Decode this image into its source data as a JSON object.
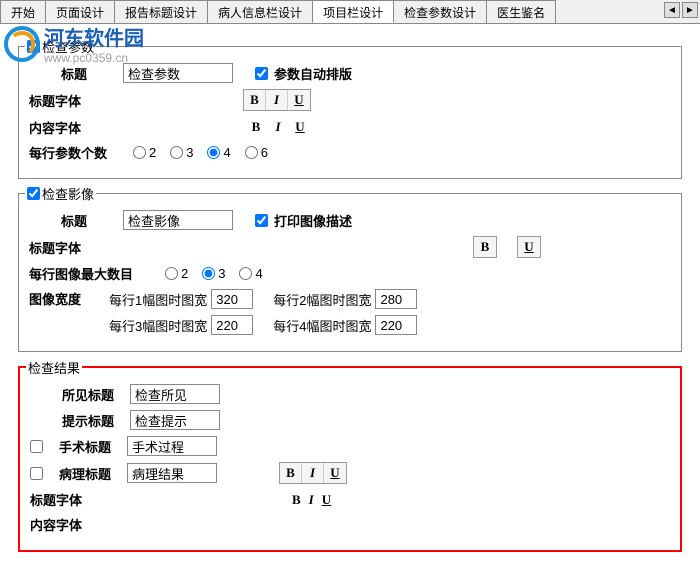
{
  "tabs": {
    "items": [
      "开始",
      "页面设计",
      "报告标题设计",
      "病人信息栏设计",
      "项目栏设计",
      "检查参数设计",
      "医生鉴名"
    ],
    "active_index": 4
  },
  "logo": {
    "cn": "河东软件园",
    "url": "www.pc0359.cn"
  },
  "group1": {
    "title": "检查参数",
    "title_label": "标题",
    "title_value": "检查参数",
    "auto_layout_label": "参数自动排版",
    "font_title_label": "标题字体",
    "font_content_label": "内容字体",
    "per_row_label": "每行参数个数",
    "per_row_options": [
      "2",
      "3",
      "4",
      "6"
    ],
    "per_row_selected": "4"
  },
  "group2": {
    "title": "检查影像",
    "title_label": "标题",
    "title_value": "检查影像",
    "print_desc_label": "打印图像描述",
    "font_title_label": "标题字体",
    "per_row_max_label": "每行图像最大数目",
    "per_row_options": [
      "2",
      "3",
      "4"
    ],
    "per_row_selected": "3",
    "img_width_label": "图像宽度",
    "width_labels": {
      "w1": "每行1幅图时图宽",
      "w2": "每行2幅图时图宽",
      "w3": "每行3幅图时图宽",
      "w4": "每行4幅图时图宽"
    },
    "width_values": {
      "w1": "320",
      "w2": "280",
      "w3": "220",
      "w4": "220"
    }
  },
  "group3": {
    "title": "检查结果",
    "seen_title_label": "所见标题",
    "seen_title_value": "检查所见",
    "hint_title_label": "提示标题",
    "hint_title_value": "检查提示",
    "surgery_title_label": "手术标题",
    "surgery_title_value": "手术过程",
    "pathology_title_label": "病理标题",
    "pathology_title_value": "病理结果",
    "font_title_label": "标题字体",
    "font_content_label": "内容字体"
  },
  "biu": {
    "b": "B",
    "i": "I",
    "u": "U"
  }
}
